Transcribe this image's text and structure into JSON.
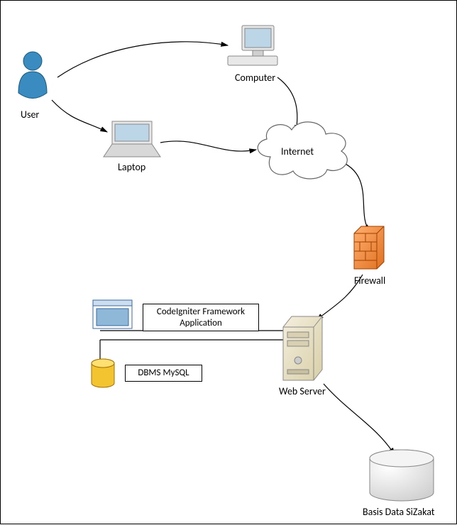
{
  "nodes": {
    "user": {
      "label": "User"
    },
    "computer": {
      "label": "Computer"
    },
    "laptop": {
      "label": "Laptop"
    },
    "internet": {
      "label": "Internet"
    },
    "firewall": {
      "label": "Firewall"
    },
    "webserver": {
      "label": "Web Server"
    },
    "codeigniter": {
      "label": "CodeIgniter Framework Application"
    },
    "dbms": {
      "label": "DBMS MySQL"
    },
    "database": {
      "label": "Basis Data SiZakat"
    }
  },
  "edges": [
    {
      "from": "user",
      "to": "computer"
    },
    {
      "from": "user",
      "to": "laptop"
    },
    {
      "from": "computer",
      "to": "internet"
    },
    {
      "from": "laptop",
      "to": "internet"
    },
    {
      "from": "internet",
      "to": "firewall"
    },
    {
      "from": "firewall",
      "to": "webserver"
    },
    {
      "from": "webserver",
      "to": "codeigniter"
    },
    {
      "from": "webserver",
      "to": "dbms"
    },
    {
      "from": "webserver",
      "to": "database"
    }
  ]
}
